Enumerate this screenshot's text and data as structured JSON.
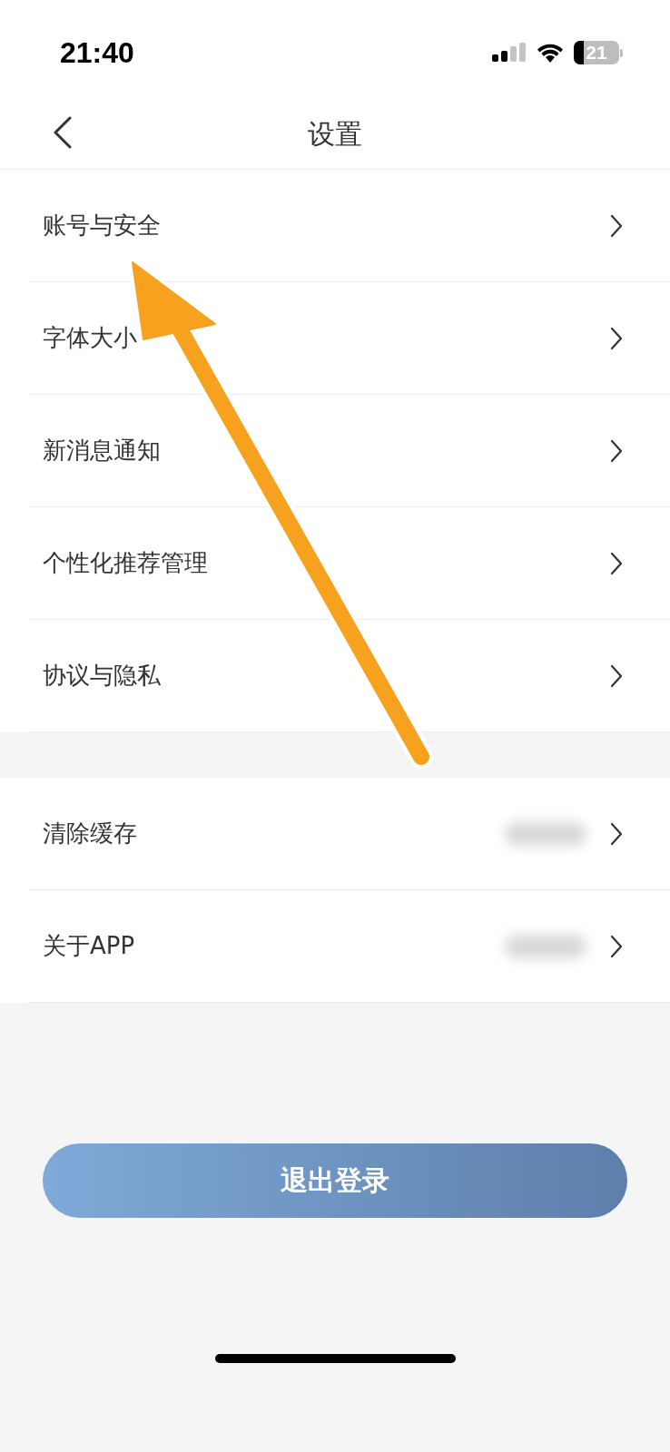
{
  "status_bar": {
    "time": "21:40",
    "battery": "21"
  },
  "nav": {
    "title": "设置"
  },
  "groups": [
    {
      "rows": [
        {
          "label": "账号与安全",
          "value_hidden": false
        },
        {
          "label": "字体大小",
          "value_hidden": false
        },
        {
          "label": "新消息通知",
          "value_hidden": false
        },
        {
          "label": "个性化推荐管理",
          "value_hidden": false
        },
        {
          "label": "协议与隐私",
          "value_hidden": false
        }
      ]
    },
    {
      "rows": [
        {
          "label": "清除缓存",
          "value_hidden": true
        },
        {
          "label": "关于APP",
          "value_hidden": true
        }
      ]
    }
  ],
  "logout_button": "退出登录"
}
